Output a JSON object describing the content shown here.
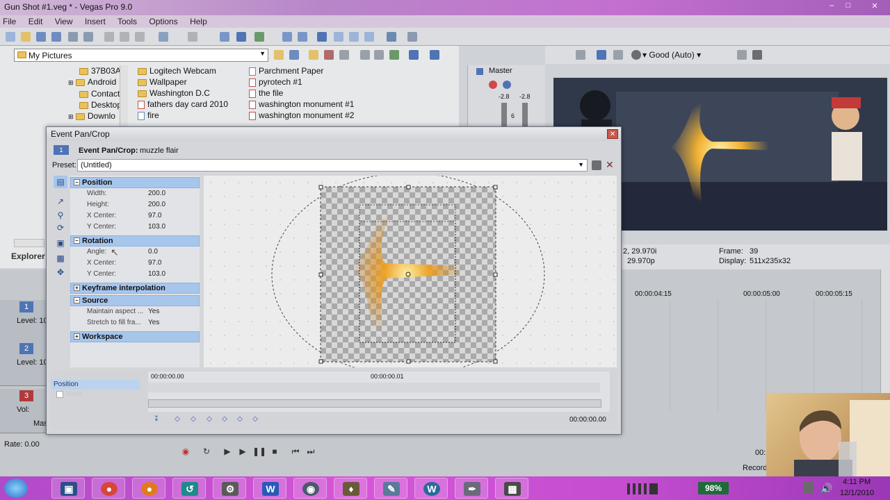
{
  "window": {
    "title": "Gun Shot #1.veg * - Vegas Pro 9.0"
  },
  "menu": [
    "File",
    "Edit",
    "View",
    "Insert",
    "Tools",
    "Options",
    "Help"
  ],
  "explorer": {
    "path": "My Pictures",
    "label": "Explorer",
    "tree": [
      "37B03A",
      "Android",
      "Contact",
      "Desktop",
      "Downlo"
    ],
    "col1": [
      "Logitech Webcam",
      "Wallpaper",
      "Washington D.C",
      "fathers day card 2010",
      "fire"
    ],
    "col2": [
      "Parchment Paper",
      "pyrotech #1",
      "the file",
      "washington monument #1",
      "washington monument #2"
    ]
  },
  "master": {
    "label": "Master",
    "meter_left": "-2.8",
    "meter_right": "-2.8",
    "scale": "6"
  },
  "preview": {
    "quality": "Good (Auto)",
    "frame_label": "Frame:",
    "frame_value": "39",
    "display_label": "Display:",
    "display_value": "511x235x32",
    "fps_1": "2, 29.970i",
    "fps_2": "29.970p"
  },
  "timeline": {
    "ruler": [
      "00:00:04:15",
      "00:00:05:00",
      "00:00:05:15"
    ],
    "tracks": [
      {
        "num": "1",
        "level": "Level: 10"
      },
      {
        "num": "2",
        "level": "Level: 10"
      },
      {
        "num": "3",
        "vol": "Vol:"
      }
    ],
    "master_label": "Mas",
    "rate": "Rate: 0.00",
    "record": "Record",
    "time_right": "00:"
  },
  "dialog": {
    "title": "Event Pan/Crop",
    "header_prefix": "Event Pan/Crop:",
    "header_clip": "muzzle flair",
    "preset_label": "Preset:",
    "preset_value": "(Untitled)",
    "sections": {
      "position": "Position",
      "rotation": "Rotation",
      "keyframe": "Keyframe interpolation",
      "source": "Source",
      "workspace": "Workspace"
    },
    "position": [
      {
        "label": "Width:",
        "value": "200.0"
      },
      {
        "label": "Height:",
        "value": "200.0"
      },
      {
        "label": "X Center:",
        "value": "97.0"
      },
      {
        "label": "Y Center:",
        "value": "103.0"
      }
    ],
    "rotation": [
      {
        "label": "Angle:",
        "value": "0.0"
      },
      {
        "label": "X Center:",
        "value": "97.0"
      },
      {
        "label": "Y Center:",
        "value": "103.0"
      }
    ],
    "source": [
      {
        "label": "Maintain aspect ...",
        "value": "Yes"
      },
      {
        "label": "Stretch to fill fra...",
        "value": "Yes"
      }
    ],
    "kf_track_label": "Position",
    "kf_times": [
      "00:00:00.00",
      "00:00:00.01"
    ],
    "kf_time_right": "00:00:00.00",
    "track_mask_label": "Mask"
  },
  "taskbar": {
    "battery": "98%",
    "time": "4:11 PM",
    "date": "12/1/2010"
  },
  "colors": {
    "selection": "#a7c6ec",
    "taskbar": "#c44dd0",
    "track1": "#4f74b5",
    "track3": "#b03a3a"
  }
}
